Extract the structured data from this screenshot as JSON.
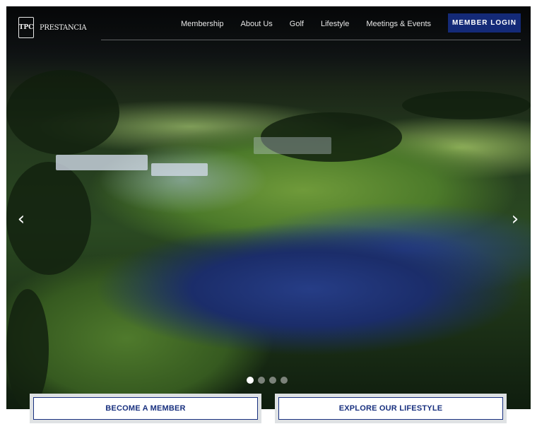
{
  "brand": {
    "badge_text": "TPC",
    "name": "PRESTANCIA"
  },
  "nav": {
    "items": [
      "Membership",
      "About Us",
      "Golf",
      "Lifestyle",
      "Meetings & Events"
    ],
    "login_label": "MEMBER LOGIN"
  },
  "carousel": {
    "prev_glyph": "‹",
    "next_glyph": "›",
    "slide_count": 4,
    "active_slide": 1
  },
  "cta": {
    "primary_label": "BECOME A MEMBER",
    "secondary_label": "EXPLORE OUR LIFESTYLE"
  },
  "colors": {
    "accent": "#142a78",
    "cta_text": "#18307f"
  },
  "icons": {
    "prev": "chevron-left-icon",
    "next": "chevron-right-icon"
  }
}
